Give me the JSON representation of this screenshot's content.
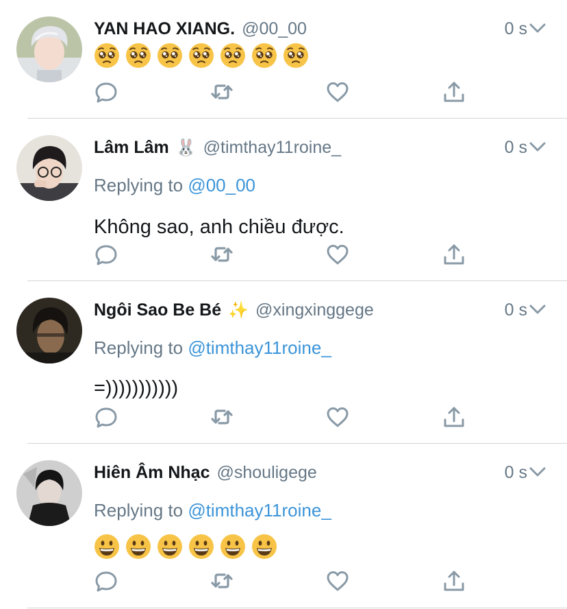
{
  "tweets": [
    {
      "name": "YAN HAO XIANG.",
      "handle": "@00_00",
      "time": "0 s",
      "emoji": "pleading-face",
      "emoji_count": 7
    },
    {
      "name": "Lâm Lâm",
      "badge": "🐰",
      "handle": "@timthay11roine_",
      "time": "0 s",
      "replying_prefix": "Replying to",
      "replying_to": "@00_00",
      "text": "Không sao, anh chiều được."
    },
    {
      "name": "Ngôi Sao Be Bé",
      "badge": "✨",
      "handle": "@xingxinggege",
      "time": "0 s",
      "replying_prefix": "Replying to",
      "replying_to": "@timthay11roine_",
      "text": "=)))))))))))"
    },
    {
      "name": "Hiên Âm Nhạc",
      "handle": "@shouligege",
      "time": "0 s",
      "replying_prefix": "Replying to",
      "replying_to": "@timthay11roine_",
      "emoji": "grinning-face",
      "emoji_count": 6
    }
  ],
  "colors": {
    "name": "#14171a",
    "secondary": "#657786",
    "mention": "#3b94d9",
    "icon": "#8899a6",
    "divider": "#d0d4d8"
  },
  "icons": [
    "reply-icon",
    "retweet-icon",
    "like-icon",
    "share-icon",
    "chevron-down-icon"
  ]
}
